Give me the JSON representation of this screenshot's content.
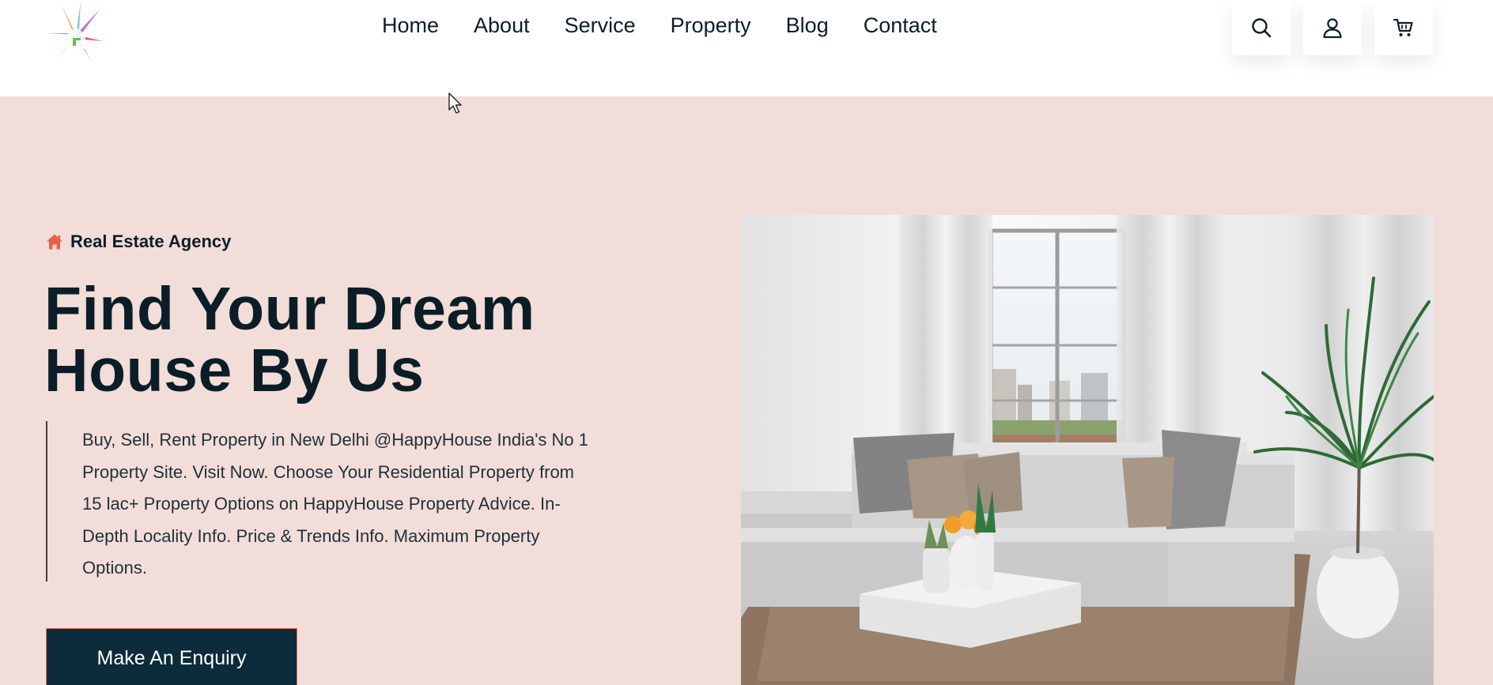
{
  "header": {
    "logo_icon": "colorful-star-house-logo",
    "nav": [
      "Home",
      "About",
      "Service",
      "Property",
      "Blog",
      "Contact"
    ],
    "actions": [
      "search-icon",
      "user-icon",
      "cart-icon"
    ]
  },
  "hero": {
    "tag": "Real Estate Agency",
    "tag_icon": "home-icon",
    "title_line1": "Find Your Dream",
    "title_line2": "House By Us",
    "description": "Buy, Sell, Rent Property in New Delhi @HappyHouse India's No 1 Property Site. Visit Now. Choose Your Residential Property from 15 lac+ Property Options on HappyHouse Property Advice. In-Depth Locality Info. Price & Trends Info. Maximum Property Options.",
    "cta": "Make An Enquiry",
    "image_subject": "living-room-interior-photo"
  },
  "colors": {
    "hero_bg": "#f3ddd8",
    "dark_navy": "#0c2b3b",
    "accent": "#e86a56",
    "text": "#0b1e27"
  }
}
